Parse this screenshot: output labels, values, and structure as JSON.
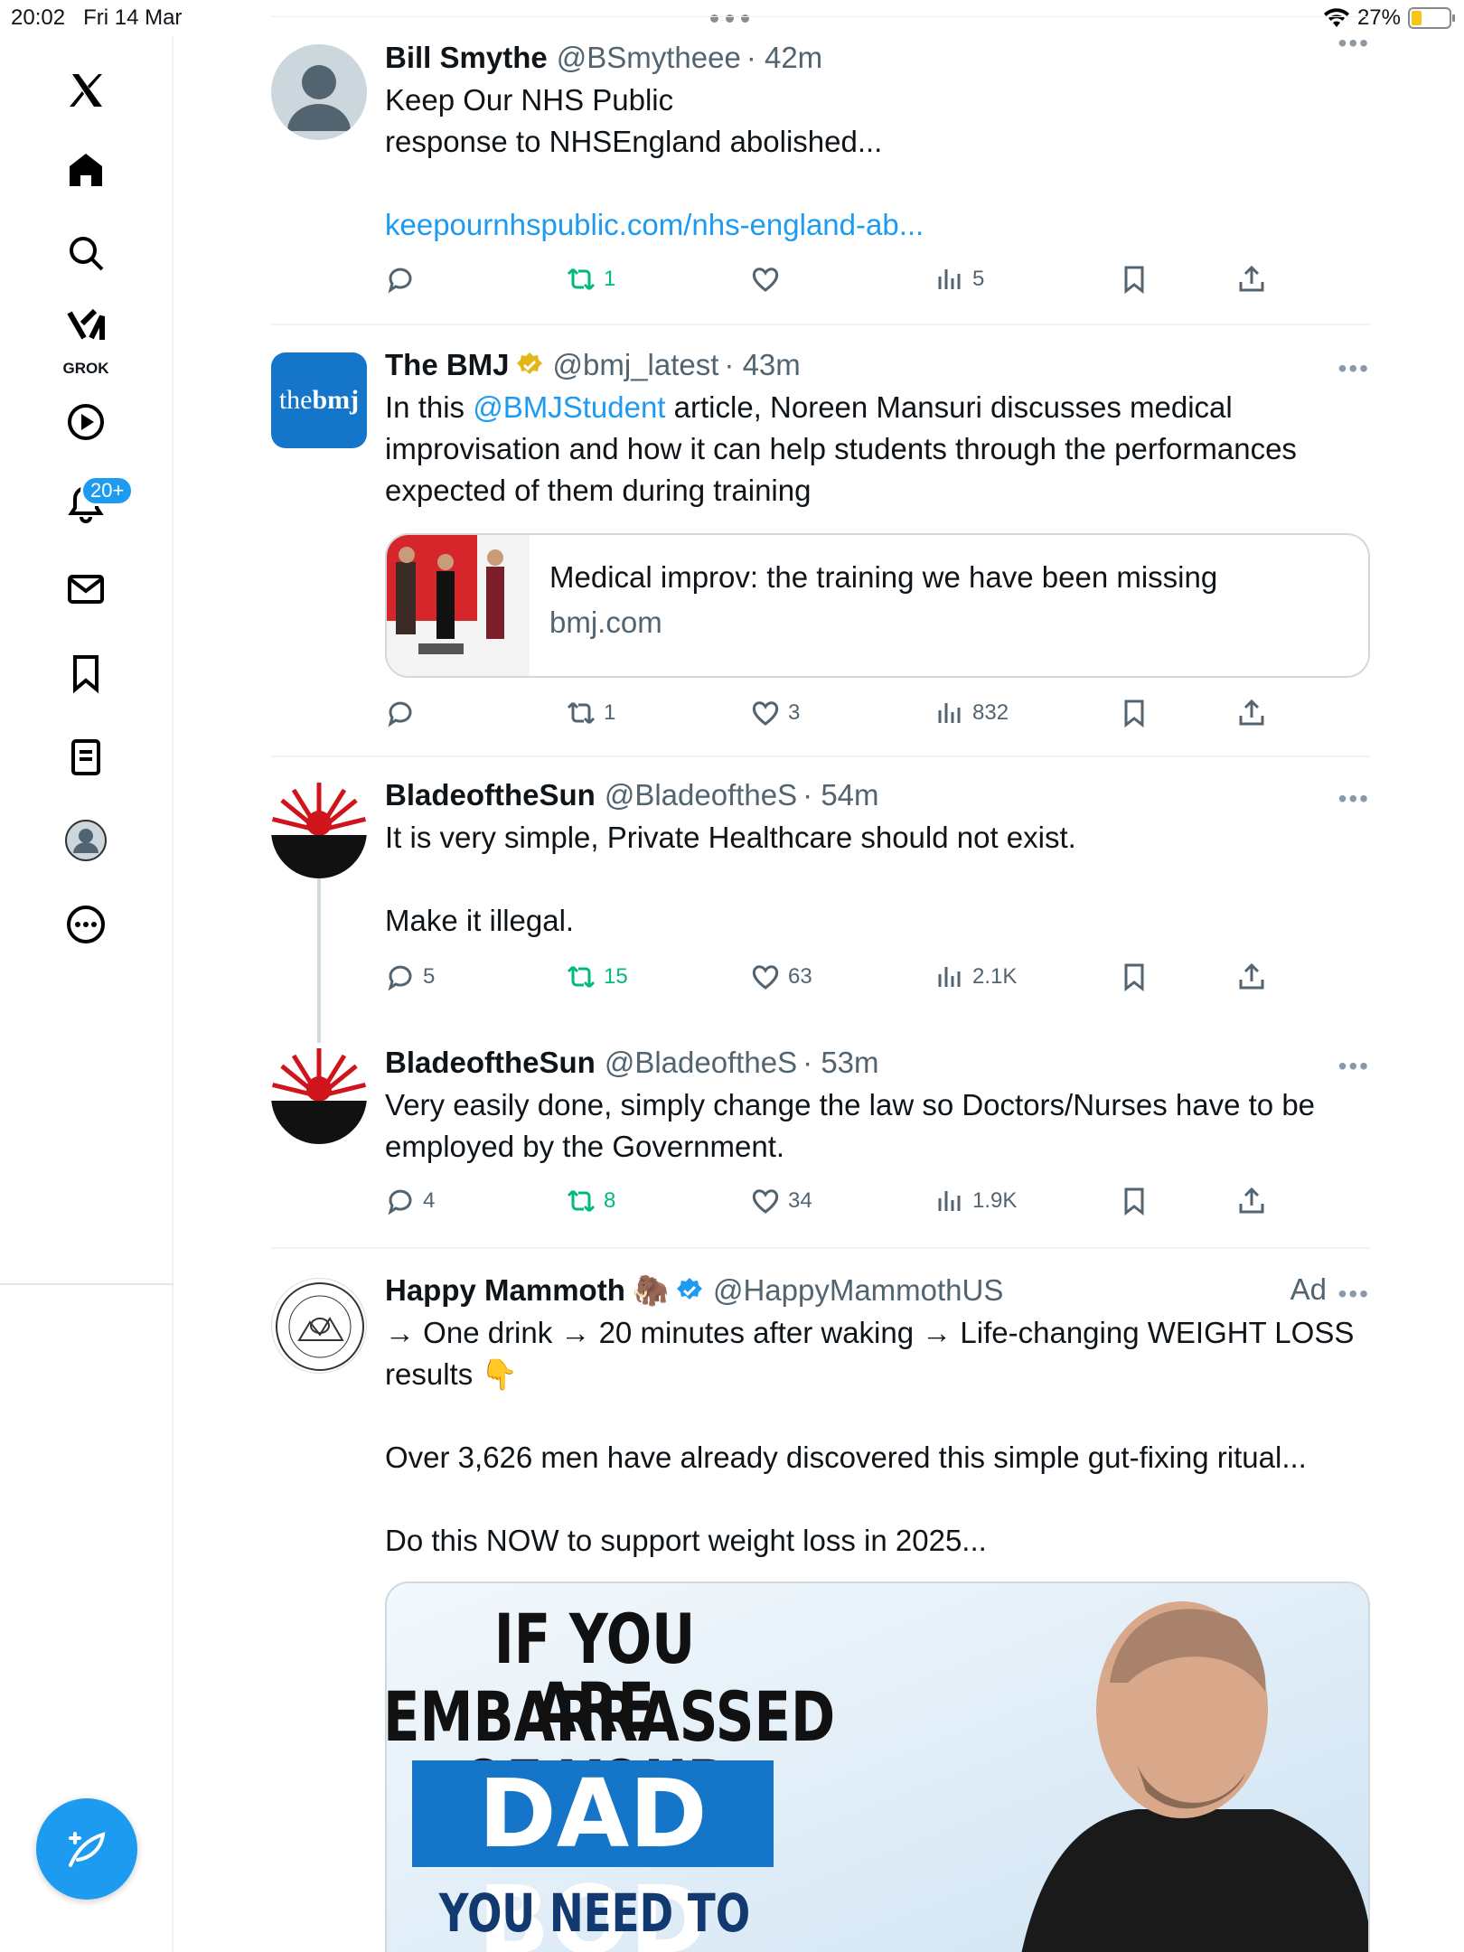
{
  "status_bar": {
    "time": "20:02",
    "date": "Fri 14 Mar",
    "battery": "27%",
    "battery_level": 0.27
  },
  "sidebar": {
    "grok_label": "GROK",
    "notifications_badge": "20+"
  },
  "tweets": [
    {
      "name": "Bill Smythe",
      "handle": "@BSmytheee",
      "time": "· 42m",
      "line1": "Keep Our NHS Public",
      "line2": "response to NHSEngland abolished...",
      "link": "keepournhspublic.com/nhs-england-ab...",
      "replies": "",
      "retweets": "1",
      "likes": "",
      "views": "5"
    },
    {
      "name": "The BMJ",
      "handle": "@bmj_latest",
      "time": "· 43m",
      "avatar_text_a": "the",
      "avatar_text_b": "bmj",
      "text_a": "In this ",
      "mention": "@BMJStudent",
      "text_b": " article, Noreen Mansuri discusses medical improvisation and how it can help students through the performances expected of them during training",
      "card_title": "Medical improv: the training we have been missing",
      "card_domain": "bmj.com",
      "replies": "",
      "retweets": "1",
      "likes": "3",
      "views": "832"
    },
    {
      "name": "BladeoftheSun",
      "handle": "@BladeoftheS",
      "time": "· 54m",
      "text": "It is very simple, Private Healthcare should not exist.\n\nMake it illegal.",
      "replies": "5",
      "retweets": "15",
      "likes": "63",
      "views": "2.1K"
    },
    {
      "name": "BladeoftheSun",
      "handle": "@BladeoftheS",
      "time": "· 53m",
      "text": "Very easily done, simply change the law so Doctors/Nurses have to be employed by the Government.",
      "replies": "4",
      "retweets": "8",
      "likes": "34",
      "views": "1.9K"
    },
    {
      "name": "Happy Mammoth",
      "emoji": "🦣",
      "handle": "@HappyMammothUS",
      "ad_label": "Ad",
      "text": "→ One drink → 20 minutes after waking → Life-changing WEIGHT LOSS results 👇\n\nOver 3,626 men have already discovered this simple gut-fixing ritual...\n\nDo this NOW to support weight loss in 2025...",
      "image_line1": "IF YOU ARE",
      "image_line2": "EMBARRASSED OF YOUR",
      "image_line3": "DAD BOD",
      "image_line4": "YOU NEED TO TAKE THIS."
    }
  ],
  "colors": {
    "accent": "#1d9bf0",
    "retweet_green": "#00ba7c",
    "muted": "#536471",
    "bmj_blue": "#1576c9",
    "gold_check": "#e2b719"
  }
}
